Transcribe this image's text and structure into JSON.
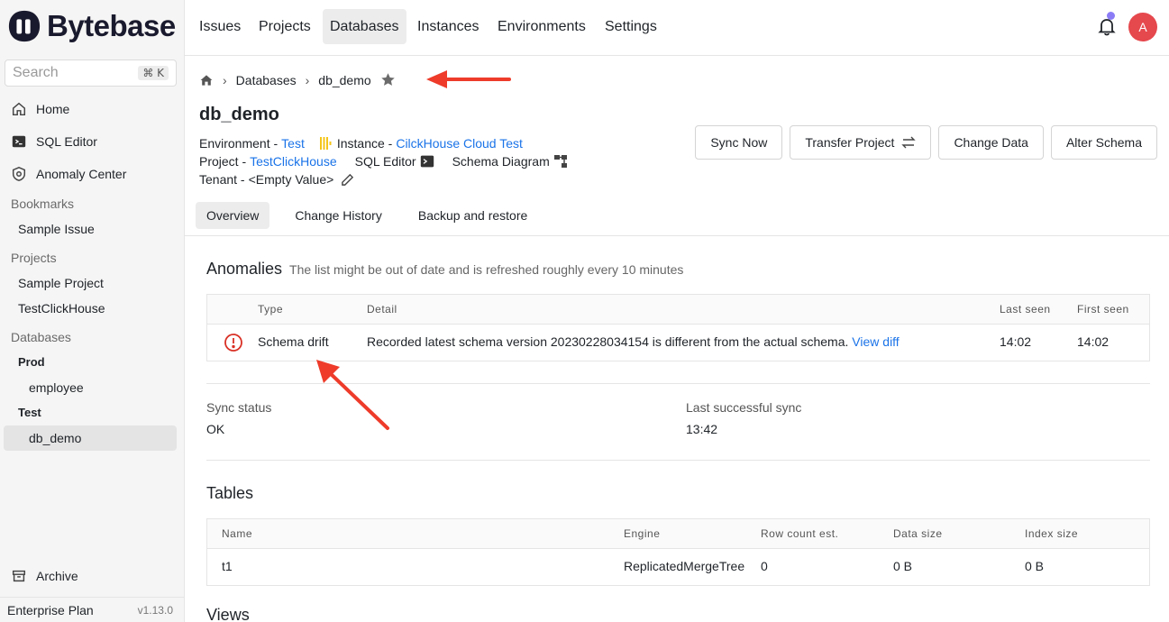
{
  "app": {
    "name": "Bytebase",
    "search_placeholder": "Search",
    "search_shortcut": "⌘ K"
  },
  "sidebar": {
    "home": "Home",
    "sql_editor": "SQL Editor",
    "anomaly_center": "Anomaly Center",
    "bookmarks_label": "Bookmarks",
    "bookmarks": [
      "Sample Issue"
    ],
    "projects_label": "Projects",
    "projects": [
      "Sample Project",
      "TestClickHouse"
    ],
    "databases_label": "Databases",
    "env_prod": "Prod",
    "prod_dbs": [
      "employee"
    ],
    "env_test": "Test",
    "test_dbs": [
      "db_demo"
    ],
    "archive": "Archive",
    "plan": "Enterprise Plan",
    "version": "v1.13.0"
  },
  "topnav": {
    "tabs": [
      "Issues",
      "Projects",
      "Databases",
      "Instances",
      "Environments",
      "Settings"
    ],
    "active_tab": "Databases",
    "avatar_initial": "A"
  },
  "breadcrumb": {
    "parent": "Databases",
    "current": "db_demo"
  },
  "database": {
    "title": "db_demo",
    "environment_label": "Environment - ",
    "environment": "Test",
    "instance_label": "Instance - ",
    "instance": "CilckHouse Cloud Test",
    "project_label": "Project - ",
    "project": "TestClickHouse",
    "sql_editor": "SQL Editor",
    "schema_diagram": "Schema Diagram",
    "tenant_label": "Tenant - ",
    "tenant": "<Empty Value>"
  },
  "actions": {
    "sync_now": "Sync Now",
    "transfer_project": "Transfer Project",
    "change_data": "Change Data",
    "alter_schema": "Alter Schema"
  },
  "subtabs": [
    "Overview",
    "Change History",
    "Backup and restore"
  ],
  "anomalies": {
    "title": "Anomalies",
    "subtitle": "The list might be out of date and is refreshed roughly every 10 minutes",
    "columns": [
      "Type",
      "Detail",
      "Last seen",
      "First seen"
    ],
    "rows": [
      {
        "type": "Schema drift",
        "detail": "Recorded latest schema version 20230228034154 is different from the actual schema.",
        "link": "View diff",
        "last_seen": "14:02",
        "first_seen": "14:02"
      }
    ]
  },
  "sync": {
    "status_label": "Sync status",
    "status": "OK",
    "last_sync_label": "Last successful sync",
    "last_sync": "13:42"
  },
  "tables": {
    "title": "Tables",
    "columns": [
      "Name",
      "Engine",
      "Row count est.",
      "Data size",
      "Index size"
    ],
    "rows": [
      {
        "name": "t1",
        "engine": "ReplicatedMergeTree",
        "rows": "0",
        "data_size": "0 B",
        "index_size": "0 B"
      }
    ]
  },
  "views": {
    "title": "Views"
  },
  "colors": {
    "link": "#1a73e8",
    "danger": "#e5484d",
    "arrow": "#ee3b2a"
  }
}
